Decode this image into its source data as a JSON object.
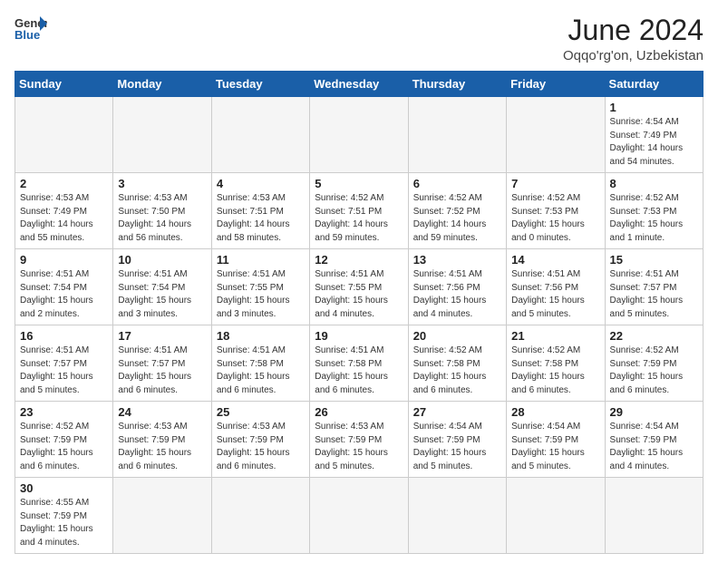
{
  "header": {
    "logo_general": "General",
    "logo_blue": "Blue",
    "month_title": "June 2024",
    "location": "Oqqo'rg'on, Uzbekistan"
  },
  "weekdays": [
    "Sunday",
    "Monday",
    "Tuesday",
    "Wednesday",
    "Thursday",
    "Friday",
    "Saturday"
  ],
  "weeks": [
    [
      {
        "day": "",
        "info": ""
      },
      {
        "day": "",
        "info": ""
      },
      {
        "day": "",
        "info": ""
      },
      {
        "day": "",
        "info": ""
      },
      {
        "day": "",
        "info": ""
      },
      {
        "day": "",
        "info": ""
      },
      {
        "day": "1",
        "info": "Sunrise: 4:54 AM\nSunset: 7:49 PM\nDaylight: 14 hours\nand 54 minutes."
      }
    ],
    [
      {
        "day": "2",
        "info": "Sunrise: 4:53 AM\nSunset: 7:49 PM\nDaylight: 14 hours\nand 55 minutes."
      },
      {
        "day": "3",
        "info": "Sunrise: 4:53 AM\nSunset: 7:50 PM\nDaylight: 14 hours\nand 56 minutes."
      },
      {
        "day": "4",
        "info": "Sunrise: 4:53 AM\nSunset: 7:51 PM\nDaylight: 14 hours\nand 58 minutes."
      },
      {
        "day": "5",
        "info": "Sunrise: 4:52 AM\nSunset: 7:51 PM\nDaylight: 14 hours\nand 59 minutes."
      },
      {
        "day": "6",
        "info": "Sunrise: 4:52 AM\nSunset: 7:52 PM\nDaylight: 14 hours\nand 59 minutes."
      },
      {
        "day": "7",
        "info": "Sunrise: 4:52 AM\nSunset: 7:53 PM\nDaylight: 15 hours\nand 0 minutes."
      },
      {
        "day": "8",
        "info": "Sunrise: 4:52 AM\nSunset: 7:53 PM\nDaylight: 15 hours\nand 1 minute."
      }
    ],
    [
      {
        "day": "9",
        "info": "Sunrise: 4:51 AM\nSunset: 7:54 PM\nDaylight: 15 hours\nand 2 minutes."
      },
      {
        "day": "10",
        "info": "Sunrise: 4:51 AM\nSunset: 7:54 PM\nDaylight: 15 hours\nand 3 minutes."
      },
      {
        "day": "11",
        "info": "Sunrise: 4:51 AM\nSunset: 7:55 PM\nDaylight: 15 hours\nand 3 minutes."
      },
      {
        "day": "12",
        "info": "Sunrise: 4:51 AM\nSunset: 7:55 PM\nDaylight: 15 hours\nand 4 minutes."
      },
      {
        "day": "13",
        "info": "Sunrise: 4:51 AM\nSunset: 7:56 PM\nDaylight: 15 hours\nand 4 minutes."
      },
      {
        "day": "14",
        "info": "Sunrise: 4:51 AM\nSunset: 7:56 PM\nDaylight: 15 hours\nand 5 minutes."
      },
      {
        "day": "15",
        "info": "Sunrise: 4:51 AM\nSunset: 7:57 PM\nDaylight: 15 hours\nand 5 minutes."
      }
    ],
    [
      {
        "day": "16",
        "info": "Sunrise: 4:51 AM\nSunset: 7:57 PM\nDaylight: 15 hours\nand 5 minutes."
      },
      {
        "day": "17",
        "info": "Sunrise: 4:51 AM\nSunset: 7:57 PM\nDaylight: 15 hours\nand 6 minutes."
      },
      {
        "day": "18",
        "info": "Sunrise: 4:51 AM\nSunset: 7:58 PM\nDaylight: 15 hours\nand 6 minutes."
      },
      {
        "day": "19",
        "info": "Sunrise: 4:51 AM\nSunset: 7:58 PM\nDaylight: 15 hours\nand 6 minutes."
      },
      {
        "day": "20",
        "info": "Sunrise: 4:52 AM\nSunset: 7:58 PM\nDaylight: 15 hours\nand 6 minutes."
      },
      {
        "day": "21",
        "info": "Sunrise: 4:52 AM\nSunset: 7:58 PM\nDaylight: 15 hours\nand 6 minutes."
      },
      {
        "day": "22",
        "info": "Sunrise: 4:52 AM\nSunset: 7:59 PM\nDaylight: 15 hours\nand 6 minutes."
      }
    ],
    [
      {
        "day": "23",
        "info": "Sunrise: 4:52 AM\nSunset: 7:59 PM\nDaylight: 15 hours\nand 6 minutes."
      },
      {
        "day": "24",
        "info": "Sunrise: 4:53 AM\nSunset: 7:59 PM\nDaylight: 15 hours\nand 6 minutes."
      },
      {
        "day": "25",
        "info": "Sunrise: 4:53 AM\nSunset: 7:59 PM\nDaylight: 15 hours\nand 6 minutes."
      },
      {
        "day": "26",
        "info": "Sunrise: 4:53 AM\nSunset: 7:59 PM\nDaylight: 15 hours\nand 5 minutes."
      },
      {
        "day": "27",
        "info": "Sunrise: 4:54 AM\nSunset: 7:59 PM\nDaylight: 15 hours\nand 5 minutes."
      },
      {
        "day": "28",
        "info": "Sunrise: 4:54 AM\nSunset: 7:59 PM\nDaylight: 15 hours\nand 5 minutes."
      },
      {
        "day": "29",
        "info": "Sunrise: 4:54 AM\nSunset: 7:59 PM\nDaylight: 15 hours\nand 4 minutes."
      }
    ],
    [
      {
        "day": "30",
        "info": "Sunrise: 4:55 AM\nSunset: 7:59 PM\nDaylight: 15 hours\nand 4 minutes."
      },
      {
        "day": "",
        "info": ""
      },
      {
        "day": "",
        "info": ""
      },
      {
        "day": "",
        "info": ""
      },
      {
        "day": "",
        "info": ""
      },
      {
        "day": "",
        "info": ""
      },
      {
        "day": "",
        "info": ""
      }
    ]
  ]
}
